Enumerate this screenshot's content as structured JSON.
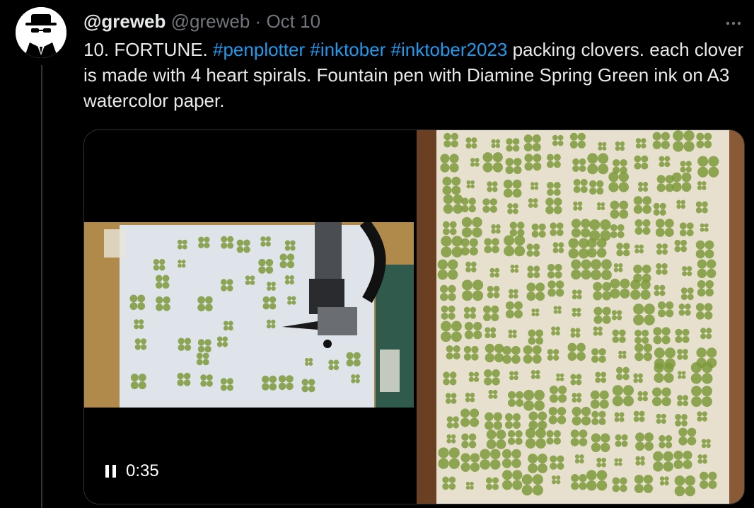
{
  "author": {
    "display_name": "@greweb",
    "handle": "@greweb",
    "separator": "·",
    "date": "Oct 10",
    "avatar_icon": "hacker-hat-avatar-icon"
  },
  "more_icon": "more-horizontal-icon",
  "tweet": {
    "prefix": "10. FORTUNE. ",
    "hashtags": [
      "#penplotter",
      "#inktober",
      "#inktober2023"
    ],
    "body": " packing clovers. each clover is made with 4 heart spirals. Fountain pen with Diamine Spring Green ink on A3 watercolor paper."
  },
  "video": {
    "time": "0:35",
    "control_icon": "pause-icon"
  },
  "colors": {
    "link": "#1d9bf0",
    "muted": "#71767b",
    "clover": "#7d9a3a"
  }
}
